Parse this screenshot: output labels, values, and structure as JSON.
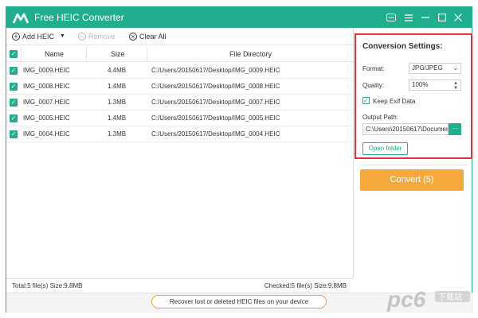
{
  "title": "Free HEIC Converter",
  "toolbar": {
    "add_label": "Add HEIC",
    "remove_label": "Remove",
    "clear_label": "Clear All"
  },
  "table": {
    "headers": {
      "name": "Name",
      "size": "Size",
      "dir": "File Directory"
    },
    "rows": [
      {
        "name": "IMG_0009.HEIC",
        "size": "4.4MB",
        "dir": "C:/Users/20150617/Desktop/IMG_0009.HEIC"
      },
      {
        "name": "IMG_0008.HEIC",
        "size": "1.4MB",
        "dir": "C:/Users/20150617/Desktop/IMG_0008.HEIC"
      },
      {
        "name": "IMG_0007.HEIC",
        "size": "1.3MB",
        "dir": "C:/Users/20150617/Desktop/IMG_0007.HEIC"
      },
      {
        "name": "IMG_0005.HEIC",
        "size": "1.4MB",
        "dir": "C:/Users/20150617/Desktop/IMG_0005.HEIC"
      },
      {
        "name": "IMG_0004.HEIC",
        "size": "1.3MB",
        "dir": "C:/Users/20150617/Desktop/IMG_0004.HEIC"
      }
    ]
  },
  "status": {
    "total": "Total:5 file(s) Size:9.8MB",
    "checked": "Checked:5 file(s) Size:9.8MB"
  },
  "recover_label": "Recover lost or deleted HEIC files on your device",
  "settings": {
    "title": "Conversion Settings:",
    "format_label": "Format:",
    "format_value": "JPG/JPEG",
    "quality_label": "Quality:",
    "quality_value": "100%",
    "exif_label": "Keep Exif Data",
    "output_label": "Output Path:",
    "output_value": "C:\\Users\\20150617\\Documen",
    "path_btn": "···",
    "open_folder": "Open folder"
  },
  "convert_label": "Convert (5)",
  "watermark": {
    "brand": "pc6",
    "sub": "下载站"
  },
  "colors": {
    "accent": "#1fae8e",
    "convert": "#f5a93c",
    "highlight_border": "#e53038"
  }
}
